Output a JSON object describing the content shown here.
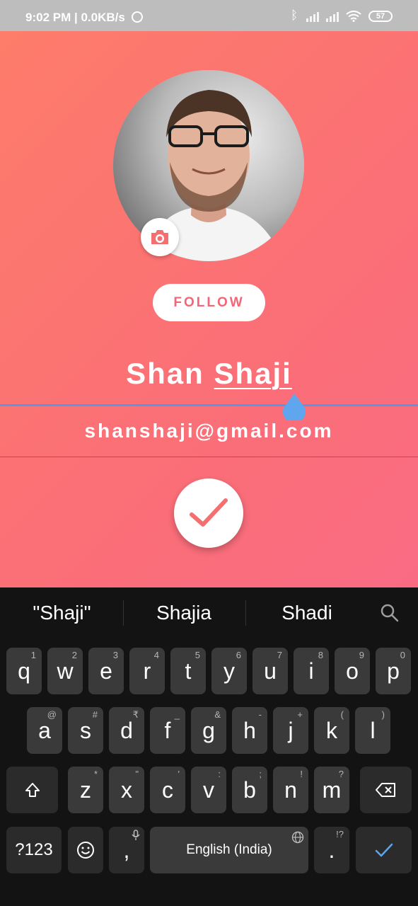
{
  "status_bar": {
    "time": "9:02 PM | 0.0KB/s",
    "battery": "57"
  },
  "profile": {
    "follow_label": "FOLLOW",
    "name_first": "Shan",
    "name_last": "Shaji",
    "email": "shanshaji@gmail.com",
    "accent": "#f46577",
    "cursor_color": "#5b96e0"
  },
  "keyboard": {
    "suggestions": [
      "\"Shaji\"",
      "Shajia",
      "Shadi"
    ],
    "row1": [
      {
        "k": "q",
        "h": "1"
      },
      {
        "k": "w",
        "h": "2"
      },
      {
        "k": "e",
        "h": "3"
      },
      {
        "k": "r",
        "h": "4"
      },
      {
        "k": "t",
        "h": "5"
      },
      {
        "k": "y",
        "h": "6"
      },
      {
        "k": "u",
        "h": "7"
      },
      {
        "k": "i",
        "h": "8"
      },
      {
        "k": "o",
        "h": "9"
      },
      {
        "k": "p",
        "h": "0"
      }
    ],
    "row2": [
      {
        "k": "a",
        "h": "@"
      },
      {
        "k": "s",
        "h": "#"
      },
      {
        "k": "d",
        "h": "₹"
      },
      {
        "k": "f",
        "h": "_"
      },
      {
        "k": "g",
        "h": "&"
      },
      {
        "k": "h",
        "h": "-"
      },
      {
        "k": "j",
        "h": "+"
      },
      {
        "k": "k",
        "h": "("
      },
      {
        "k": "l",
        "h": ")"
      }
    ],
    "row3": [
      {
        "k": "z",
        "h": "*"
      },
      {
        "k": "x",
        "h": "\""
      },
      {
        "k": "c",
        "h": "'"
      },
      {
        "k": "v",
        "h": ":"
      },
      {
        "k": "b",
        "h": ";"
      },
      {
        "k": "n",
        "h": "!"
      },
      {
        "k": "m",
        "h": "?"
      }
    ],
    "symbols_label": "?123",
    "comma": ",",
    "space_label": "English (India)",
    "period": ".",
    "period_hint": "!?"
  }
}
